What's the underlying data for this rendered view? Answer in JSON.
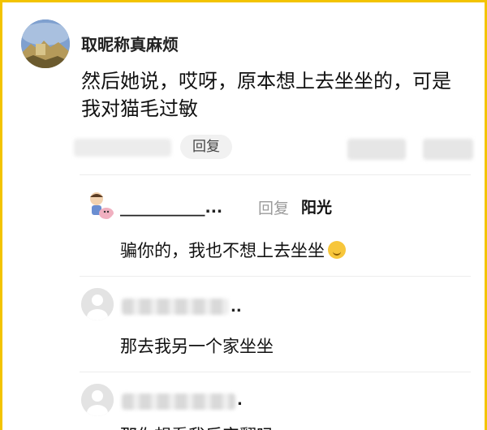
{
  "comment": {
    "username": "取昵称真麻烦",
    "text": "然后她说，哎呀，原本想上去坐坐的，可是我对猫毛过敏",
    "reply_label": "回复"
  },
  "replies": [
    {
      "author": "___________...",
      "reply_label": "回复",
      "reply_to": "阳光",
      "text": "骗你的，我也不想上去坐坐",
      "emoji": "smile-emoji"
    },
    {
      "author_suffix": "..",
      "text": "那去我另一个家坐坐"
    },
    {
      "author_suffix": ".",
      "text": "那你想看我后宫翻吗"
    }
  ],
  "colors": {
    "frame": "#f3c400",
    "muted": "#9a9a9a",
    "pill_bg": "#f1f1f1"
  }
}
